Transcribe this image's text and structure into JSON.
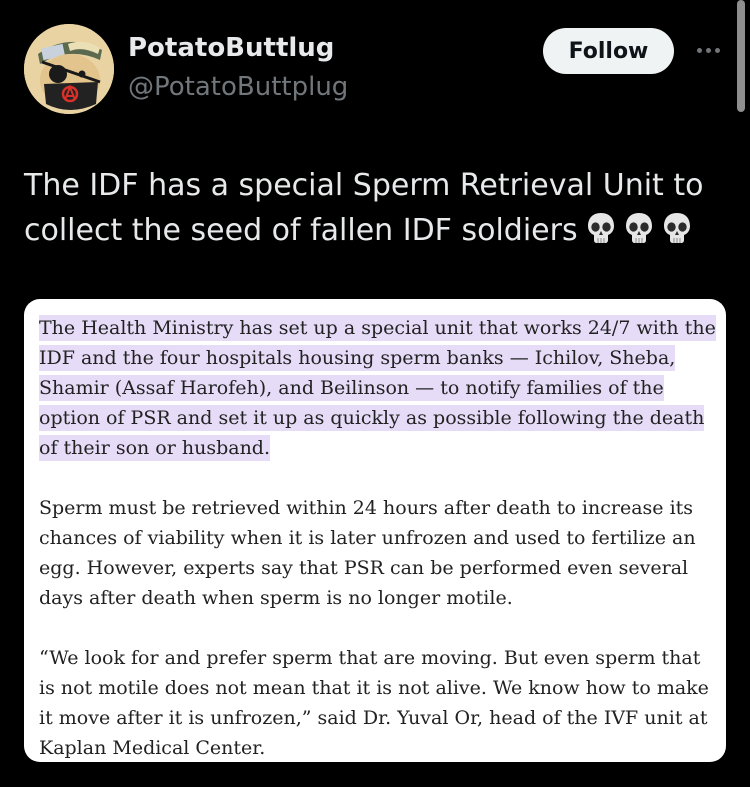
{
  "author": {
    "display_name": "PotatoButtlug",
    "handle": "@PotatoButtplug",
    "avatar_icon": "avatar-pirate-potato-icon"
  },
  "actions": {
    "follow_label": "Follow",
    "more_icon": "more-horizontal-icon"
  },
  "tweet": {
    "text": "The IDF has a special Sperm Retrieval Unit to collect the seed of fallen IDF soldiers",
    "emoji": [
      "skull-icon",
      "skull-icon",
      "skull-icon"
    ]
  },
  "media": {
    "paragraphs": [
      {
        "text": "The Health Ministry has set up a special unit that works 24/7 with the IDF and the four hospitals housing sperm banks — Ichilov, Sheba, Shamir (Assaf Harofeh), and Beilinson — to notify families of the option of PSR and set it up as quickly as possible following the death of their son or husband.",
        "highlighted": true
      },
      {
        "text": "Sperm must be retrieved within 24 hours after death to increase its chances of viability when it is later unfrozen and used to fertilize an egg. However, experts say that PSR can be performed even several days after death when sperm is no longer motile.",
        "highlighted": false
      },
      {
        "text": "“We look for and prefer sperm that are moving. But even sperm that is not motile does not mean that it is not alive. We know how to make it move after it is unfrozen,” said Dr. Yuval Or, head of the IVF unit at Kaplan Medical Center.",
        "highlighted": false
      }
    ]
  },
  "colors": {
    "background": "#000000",
    "text_primary": "#e7e9ea",
    "text_secondary": "#71767b",
    "follow_bg": "#eff3f4",
    "highlight": "#e6dcf8"
  }
}
